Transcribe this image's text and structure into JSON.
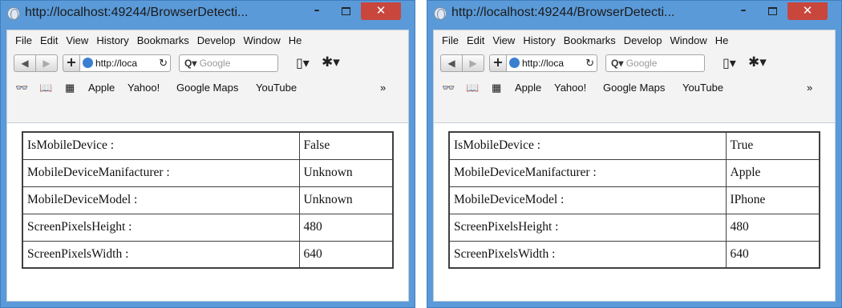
{
  "windows": [
    {
      "title": "http://localhost:49244/BrowserDetecti...",
      "menu": [
        "File",
        "Edit",
        "View",
        "History",
        "Bookmarks",
        "Develop",
        "Window",
        "He"
      ],
      "address": "http://loca",
      "search_placeholder": "Google",
      "bookmarks": [
        "Apple",
        "Yahoo!",
        "Google Maps",
        "YouTube"
      ],
      "rows": [
        {
          "key": "IsMobileDevice :",
          "value": "False"
        },
        {
          "key": "MobileDeviceManifacturer :",
          "value": "Unknown"
        },
        {
          "key": "MobileDeviceModel :",
          "value": "Unknown"
        },
        {
          "key": "ScreenPixelsHeight :",
          "value": "480"
        },
        {
          "key": "ScreenPixelsWidth :",
          "value": "640"
        }
      ]
    },
    {
      "title": "http://localhost:49244/BrowserDetecti...",
      "menu": [
        "File",
        "Edit",
        "View",
        "History",
        "Bookmarks",
        "Develop",
        "Window",
        "He"
      ],
      "address": "http://loca",
      "search_placeholder": "Google",
      "bookmarks": [
        "Apple",
        "Yahoo!",
        "Google Maps",
        "YouTube"
      ],
      "rows": [
        {
          "key": "IsMobileDevice :",
          "value": "True"
        },
        {
          "key": "MobileDeviceManifacturer :",
          "value": "Apple"
        },
        {
          "key": "MobileDeviceModel :",
          "value": "IPhone"
        },
        {
          "key": "ScreenPixelsHeight :",
          "value": "480"
        },
        {
          "key": "ScreenPixelsWidth :",
          "value": "640"
        }
      ]
    }
  ],
  "glyphs": {
    "minimize": "–",
    "close": "✕",
    "back": "◀",
    "forward": "▶",
    "new_tab": "+",
    "reload": "↻",
    "search_q": "Q▾",
    "page_menu": "▯▾",
    "gear": "✱▾",
    "reader": "👓",
    "bookmark_book": "📖",
    "grid": "▦",
    "overflow": "»"
  },
  "colors": {
    "titlebar": "#5a9ad8",
    "close_button": "#c9463d"
  }
}
